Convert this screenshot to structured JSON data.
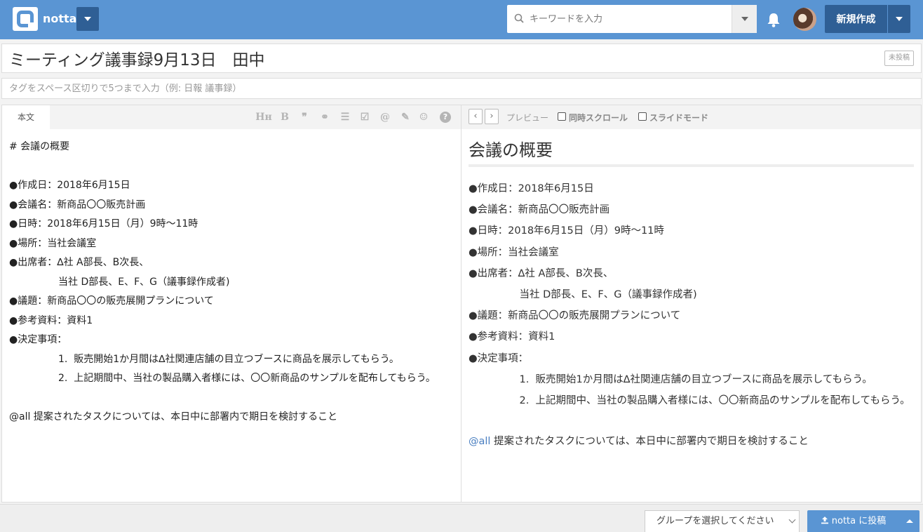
{
  "header": {
    "brand": "notta",
    "search_placeholder": "キーワードを入力",
    "new_button": "新規作成"
  },
  "title": {
    "value": "ミーティング議事録9月13日　田中",
    "status_badge": "未投稿"
  },
  "tags": {
    "placeholder": "タグをスペース区切りで5つまで入力（例: 日報 議事録）"
  },
  "editor": {
    "tab_label": "本文",
    "toolbar": [
      {
        "name": "heading-icon",
        "glyph": "Hн"
      },
      {
        "name": "bold-icon",
        "glyph": "B"
      },
      {
        "name": "quote-icon",
        "glyph": "❞"
      },
      {
        "name": "link-icon",
        "glyph": "⚭"
      },
      {
        "name": "list-icon",
        "glyph": "☰"
      },
      {
        "name": "checkbox-icon",
        "glyph": "☑"
      },
      {
        "name": "mention-icon",
        "glyph": "@"
      },
      {
        "name": "attachment-icon",
        "glyph": "✎"
      },
      {
        "name": "emoji-icon",
        "glyph": "☺"
      },
      {
        "name": "help-icon",
        "glyph": "?"
      }
    ],
    "lines": [
      "# 会議の概要",
      "",
      "●作成日：2018年6月15日",
      "●会議名：新商品〇〇販売計画",
      "●日時：2018年6月15日（月）9時〜11時",
      "●場所：当社会議室",
      "●出席者：∆社 A部長、B次長、",
      "　　　　　当社 D部長、E、F、G（議事録作成者)",
      "●議題：新商品〇〇の販売展開プランについて",
      "●参考資料：資料1",
      "●決定事項：",
      "　　　　　1.  販売開始1か月間は∆社関連店舗の目立つブースに商品を展示してもらう。",
      "　　　　　2.  上記期間中、当社の製品購入者様には、〇〇新商品のサンプルを配布してもらう。",
      "",
      "@all 提案されたタスクについては、本日中に部署内で期日を検討すること"
    ]
  },
  "preview": {
    "label": "プレビュー",
    "sync_scroll": "同時スクロール",
    "slide_mode": "スライドモード",
    "heading": "会議の概要",
    "lines": [
      "●作成日：2018年6月15日",
      "●会議名：新商品〇〇販売計画",
      "●日時：2018年6月15日（月）9時〜11時",
      "●場所：当社会議室",
      "●出席者：∆社 A部長、B次長、",
      "　　　　　当社 D部長、E、F、G（議事録作成者)",
      "●議題：新商品〇〇の販売展開プランについて",
      "●参考資料：資料1",
      "●決定事項：",
      "　　　　　1.  販売開始1か月間は∆社関連店舗の目立つブースに商品を展示してもらう。",
      "　　　　　2.  上記期間中、当社の製品購入者様には、〇〇新商品のサンプルを配布してもらう。"
    ],
    "mention": "@all",
    "mention_text": " 提案されたタスクについては、本日中に部署内で期日を検討すること"
  },
  "footer": {
    "group_select": "グループを選択してください",
    "post_button": "notta に投稿"
  },
  "colors": {
    "header_bg": "#5a95d3",
    "button_dark": "#2f5f95",
    "mention": "#4a7fc1"
  }
}
